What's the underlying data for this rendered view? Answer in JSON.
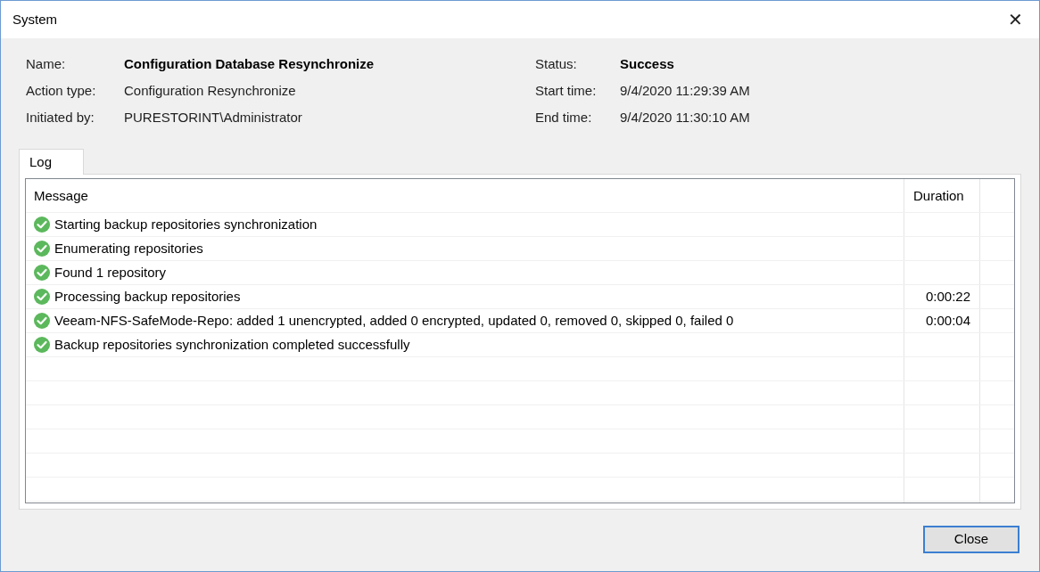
{
  "window": {
    "title": "System",
    "close_glyph": "✕"
  },
  "details": {
    "left": [
      {
        "label": "Name:",
        "value": "Configuration Database Resynchronize",
        "bold": true
      },
      {
        "label": "Action type:",
        "value": "Configuration Resynchronize",
        "bold": false
      },
      {
        "label": "Initiated by:",
        "value": "PURESTORINT\\Administrator",
        "bold": false
      }
    ],
    "right": [
      {
        "label": "Status:",
        "value": "Success",
        "bold": true
      },
      {
        "label": "Start time:",
        "value": "9/4/2020 11:29:39 AM",
        "bold": false
      },
      {
        "label": "End time:",
        "value": "9/4/2020 11:30:10 AM",
        "bold": false
      }
    ]
  },
  "tabs": [
    {
      "label": "Log",
      "selected": true
    }
  ],
  "log": {
    "columns": [
      "Message",
      "Duration"
    ],
    "rows": [
      {
        "kind": "success",
        "message": "Starting backup repositories synchronization",
        "duration": ""
      },
      {
        "kind": "success",
        "message": "Enumerating repositories",
        "duration": ""
      },
      {
        "kind": "success",
        "message": "Found 1 repository",
        "duration": ""
      },
      {
        "kind": "success",
        "message": "Processing backup repositories",
        "duration": "0:00:22"
      },
      {
        "kind": "success",
        "message": "Veeam-NFS-SafeMode-Repo: added 1 unencrypted, added 0 encrypted, updated 0, removed 0, skipped 0, failed 0",
        "duration": "0:00:04"
      },
      {
        "kind": "success",
        "message": "Backup repositories synchronization completed successfully",
        "duration": ""
      }
    ]
  },
  "buttons": [
    "Close"
  ]
}
